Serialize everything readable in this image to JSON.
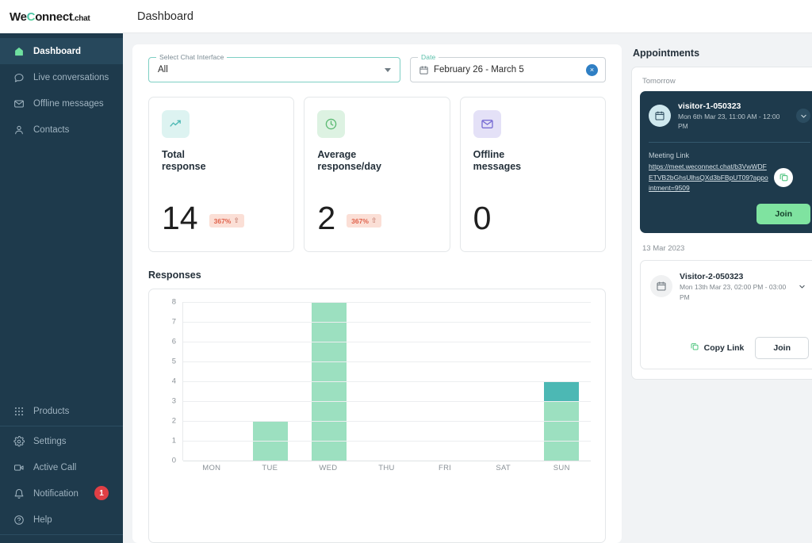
{
  "brand": {
    "logo_part1": "We",
    "logo_c": "C",
    "logo_part2": "onnect",
    "logo_tld": ".chat",
    "accent_green": "#7fe3a0",
    "accent_teal": "#4cb8b4",
    "sidebar_bg": "#1e3a4c",
    "bar_light": "#9ce0c0",
    "bar_dark": "#4cb8b4",
    "badge_red": "#e03f45"
  },
  "header": {
    "title": "Dashboard"
  },
  "sidebar": {
    "top_items": [
      {
        "label": "Dashboard",
        "icon": "home-icon",
        "active": true
      },
      {
        "label": "Live conversations",
        "icon": "chat-bubble-icon",
        "active": false
      },
      {
        "label": "Offline messages",
        "icon": "envelope-icon",
        "active": false
      },
      {
        "label": "Contacts",
        "icon": "person-icon",
        "active": false
      }
    ],
    "bottom_items": [
      {
        "label": "Products",
        "icon": "grid-icon",
        "badge": null
      },
      {
        "label": "Settings",
        "icon": "gear-icon",
        "badge": null
      },
      {
        "label": "Active Call",
        "icon": "video-camera-icon",
        "badge": null
      },
      {
        "label": "Notification",
        "icon": "bell-icon",
        "badge": "1"
      },
      {
        "label": "Help",
        "icon": "question-circle-icon",
        "badge": null
      }
    ]
  },
  "filters": {
    "chat_interface": {
      "legend": "Select Chat Interface",
      "value": "All"
    },
    "date": {
      "legend": "Date",
      "value": "February 26 - March 5",
      "clear_glyph": "×"
    }
  },
  "stats": [
    {
      "label": "Total\nresponse",
      "label_l1": "Total",
      "label_l2": "response",
      "value": "14",
      "delta": "367%",
      "delta_arrow": "⇧",
      "icon": "trending-up-icon",
      "icon_bg": "#ddf3f1",
      "icon_color": "#4cb8b4"
    },
    {
      "label_l1": "Average",
      "label_l2": "response/day",
      "value": "2",
      "delta": "367%",
      "delta_arrow": "⇧",
      "icon": "clock-icon",
      "icon_bg": "#ddf2e2",
      "icon_color": "#5cba73"
    },
    {
      "label_l1": "Offline",
      "label_l2": "messages",
      "value": "0",
      "delta": null,
      "icon": "envelope-icon",
      "icon_bg": "#e4e1f7",
      "icon_color": "#7a6fd4"
    }
  ],
  "responses": {
    "title": "Responses"
  },
  "chart_data": {
    "type": "bar",
    "title": "Responses",
    "xlabel": "",
    "ylabel": "",
    "ylim": [
      0,
      8
    ],
    "yticks": [
      "8",
      "7",
      "6",
      "5",
      "4",
      "3",
      "2",
      "1",
      "0"
    ],
    "grid": true,
    "stacked": true,
    "categories": [
      "MON",
      "TUE",
      "WED",
      "THU",
      "FRI",
      "SAT",
      "SUN"
    ],
    "series": [
      {
        "name": "responses-light",
        "color": "#9ce0c0",
        "values": [
          0,
          2,
          8,
          0,
          0,
          0,
          3
        ]
      },
      {
        "name": "responses-dark",
        "color": "#4cb8b4",
        "values": [
          0,
          0,
          0,
          0,
          0,
          0,
          1
        ]
      }
    ],
    "totals": [
      0,
      2,
      8,
      0,
      0,
      0,
      4
    ]
  },
  "appointments": {
    "title": "Appointments",
    "groups": [
      {
        "day_label": "Tomorrow",
        "card": {
          "style": "dark",
          "name": "visitor-1-050323",
          "time": "Mon 6th Mar 23, 11:00 AM - 12:00 PM",
          "meeting_link_label": "Meeting Link",
          "meeting_link": "https://meet.weconnect.chat/b3VwWDFETVB2bGhsUlhsQXd3bFBpUT09?appointment=9509",
          "join_label": "Join"
        }
      },
      {
        "day_label": "13 Mar 2023",
        "card": {
          "style": "light",
          "name": "Visitor-2-050323",
          "time": "Mon 13th Mar 23, 02:00 PM - 03:00 PM",
          "copy_label": "Copy Link",
          "join_label": "Join"
        }
      }
    ]
  }
}
